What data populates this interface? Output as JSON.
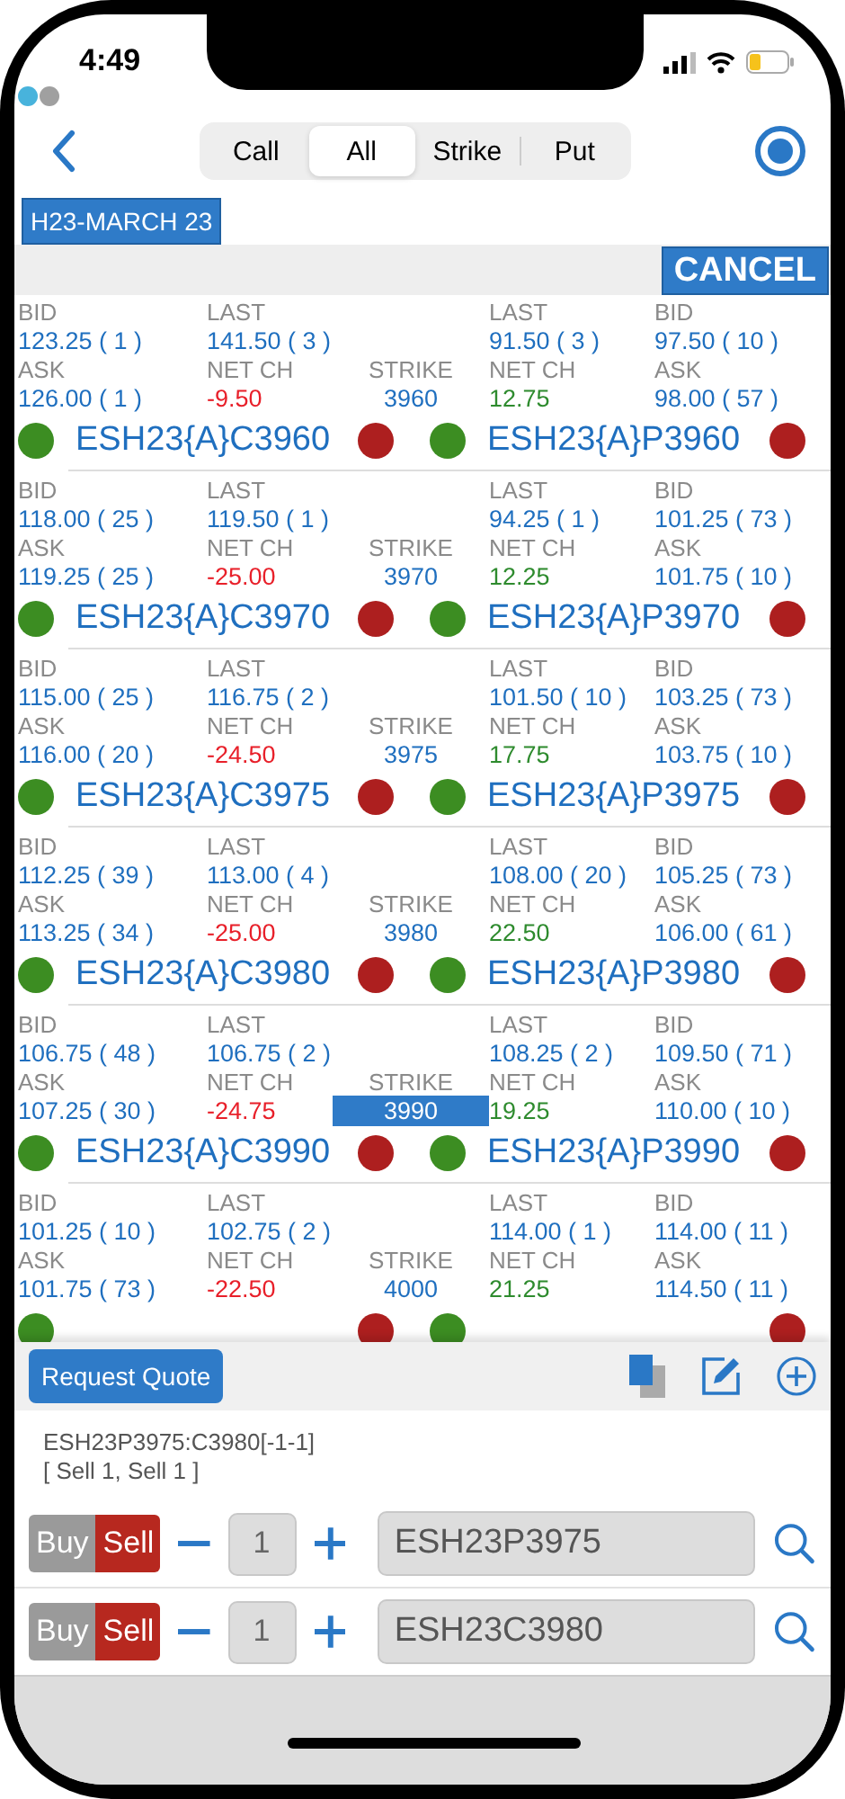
{
  "status_bar": {
    "time": "4:49"
  },
  "tabs": [
    {
      "label": "Call",
      "selected": false
    },
    {
      "label": "All",
      "selected": true
    },
    {
      "label": "Strike",
      "selected": false
    },
    {
      "label": "Put",
      "selected": false
    }
  ],
  "expiry": "H23-MARCH 23",
  "cancel_button": "CANCEL",
  "rows": [
    {
      "strike": {
        "label": "STRIKE",
        "value": "3960",
        "selected": false
      },
      "call": {
        "bid": {
          "label": "BID",
          "value": "123.25 ( 1 )"
        },
        "last": {
          "label": "LAST",
          "value": "141.50 ( 3 )"
        },
        "ask": {
          "label": "ASK",
          "value": "126.00 ( 1 )"
        },
        "net_ch": {
          "label": "NET CH",
          "value": "-9.50",
          "color": "#e8202a"
        },
        "symbol": "ESH23{A}C3960"
      },
      "put": {
        "last": {
          "label": "LAST",
          "value": "91.50 ( 3 )"
        },
        "bid": {
          "label": "BID",
          "value": "97.50 ( 10 )"
        },
        "net_ch": {
          "label": "NET CH",
          "value": "12.75",
          "color": "#2e8b2e"
        },
        "ask": {
          "label": "ASK",
          "value": "98.00 ( 57 )"
        },
        "symbol": "ESH23{A}P3960"
      }
    },
    {
      "strike": {
        "label": "STRIKE",
        "value": "3970",
        "selected": false
      },
      "call": {
        "bid": {
          "label": "BID",
          "value": "118.00 ( 25 )"
        },
        "last": {
          "label": "LAST",
          "value": "119.50 ( 1 )"
        },
        "ask": {
          "label": "ASK",
          "value": "119.25 ( 25 )"
        },
        "net_ch": {
          "label": "NET CH",
          "value": "-25.00",
          "color": "#e8202a"
        },
        "symbol": "ESH23{A}C3970"
      },
      "put": {
        "last": {
          "label": "LAST",
          "value": "94.25 ( 1 )"
        },
        "bid": {
          "label": "BID",
          "value": "101.25 ( 73 )"
        },
        "net_ch": {
          "label": "NET CH",
          "value": "12.25",
          "color": "#2e8b2e"
        },
        "ask": {
          "label": "ASK",
          "value": "101.75 ( 10 )"
        },
        "symbol": "ESH23{A}P3970"
      }
    },
    {
      "strike": {
        "label": "STRIKE",
        "value": "3975",
        "selected": false
      },
      "call": {
        "bid": {
          "label": "BID",
          "value": "115.00 ( 25 )"
        },
        "last": {
          "label": "LAST",
          "value": "116.75 ( 2 )"
        },
        "ask": {
          "label": "ASK",
          "value": "116.00 ( 20 )"
        },
        "net_ch": {
          "label": "NET CH",
          "value": "-24.50",
          "color": "#e8202a"
        },
        "symbol": "ESH23{A}C3975"
      },
      "put": {
        "last": {
          "label": "LAST",
          "value": "101.50 ( 10 )"
        },
        "bid": {
          "label": "BID",
          "value": "103.25 ( 73 )"
        },
        "net_ch": {
          "label": "NET CH",
          "value": "17.75",
          "color": "#2e8b2e"
        },
        "ask": {
          "label": "ASK",
          "value": "103.75 ( 10 )"
        },
        "symbol": "ESH23{A}P3975"
      }
    },
    {
      "strike": {
        "label": "STRIKE",
        "value": "3980",
        "selected": false
      },
      "call": {
        "bid": {
          "label": "BID",
          "value": "112.25 ( 39 )"
        },
        "last": {
          "label": "LAST",
          "value": "113.00 ( 4 )"
        },
        "ask": {
          "label": "ASK",
          "value": "113.25 ( 34 )"
        },
        "net_ch": {
          "label": "NET CH",
          "value": "-25.00",
          "color": "#e8202a"
        },
        "symbol": "ESH23{A}C3980"
      },
      "put": {
        "last": {
          "label": "LAST",
          "value": "108.00 ( 20 )"
        },
        "bid": {
          "label": "BID",
          "value": "105.25 ( 73 )"
        },
        "net_ch": {
          "label": "NET CH",
          "value": "22.50",
          "color": "#2e8b2e"
        },
        "ask": {
          "label": "ASK",
          "value": "106.00 ( 61 )"
        },
        "symbol": "ESH23{A}P3980"
      }
    },
    {
      "strike": {
        "label": "STRIKE",
        "value": "3990",
        "selected": true
      },
      "call": {
        "bid": {
          "label": "BID",
          "value": "106.75 ( 48 )"
        },
        "last": {
          "label": "LAST",
          "value": "106.75 ( 2 )"
        },
        "ask": {
          "label": "ASK",
          "value": "107.25 ( 30 )"
        },
        "net_ch": {
          "label": "NET CH",
          "value": "-24.75",
          "color": "#e8202a"
        },
        "symbol": "ESH23{A}C3990"
      },
      "put": {
        "last": {
          "label": "LAST",
          "value": "108.25 ( 2 )"
        },
        "bid": {
          "label": "BID",
          "value": "109.50 ( 71 )"
        },
        "net_ch": {
          "label": "NET CH",
          "value": "19.25",
          "color": "#2e8b2e"
        },
        "ask": {
          "label": "ASK",
          "value": "110.00 ( 10 )"
        },
        "symbol": "ESH23{A}P3990"
      }
    },
    {
      "strike": {
        "label": "STRIKE",
        "value": "4000",
        "selected": false
      },
      "call": {
        "bid": {
          "label": "BID",
          "value": "101.25 ( 10 )"
        },
        "last": {
          "label": "LAST",
          "value": "102.75 ( 2 )"
        },
        "ask": {
          "label": "ASK",
          "value": "101.75 ( 73 )"
        },
        "net_ch": {
          "label": "NET CH",
          "value": "-22.50",
          "color": "#e8202a"
        }
      },
      "put": {
        "last": {
          "label": "LAST",
          "value": "114.00 ( 1 )"
        },
        "bid": {
          "label": "BID",
          "value": "114.00 ( 11 )"
        },
        "net_ch": {
          "label": "NET CH",
          "value": "21.25",
          "color": "#2e8b2e"
        },
        "ask": {
          "label": "ASK",
          "value": "114.50 ( 11 )"
        }
      }
    }
  ],
  "order": {
    "request_button": "Request Quote",
    "spread": "ESH23P3975:C3980[-1-1]",
    "legs_summary": "[ Sell 1, Sell 1 ]",
    "legs": [
      {
        "sides": [
          {
            "label": "Buy",
            "selected": false
          },
          {
            "label": "Sell",
            "selected": true
          }
        ],
        "quantity": "1",
        "symbol": "ESH23P3975"
      },
      {
        "sides": [
          {
            "label": "Buy",
            "selected": false
          },
          {
            "label": "Sell",
            "selected": true
          }
        ],
        "quantity": "1",
        "symbol": "ESH23C3980"
      }
    ]
  }
}
